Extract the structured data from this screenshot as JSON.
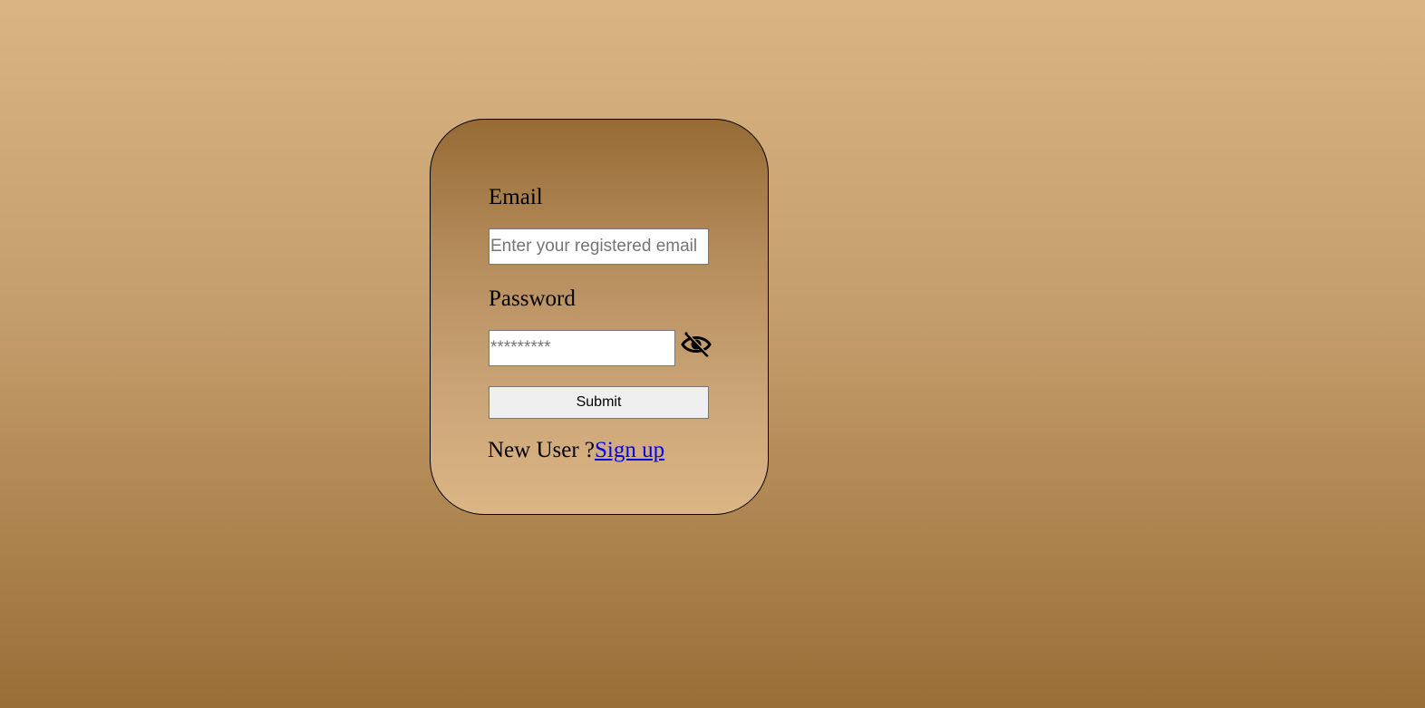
{
  "login_form": {
    "email_label": "Email",
    "email_placeholder": "Enter your registered email",
    "email_value": "",
    "password_label": "Password",
    "password_placeholder": "*********",
    "password_value": "",
    "password_toggle_icon": "eye-slash-icon",
    "submit_label": "Submit",
    "new_user_text": "New User ?",
    "signup_link_text": "Sign up"
  },
  "colors": {
    "link": "#0000ee",
    "card_border": "#000000"
  }
}
